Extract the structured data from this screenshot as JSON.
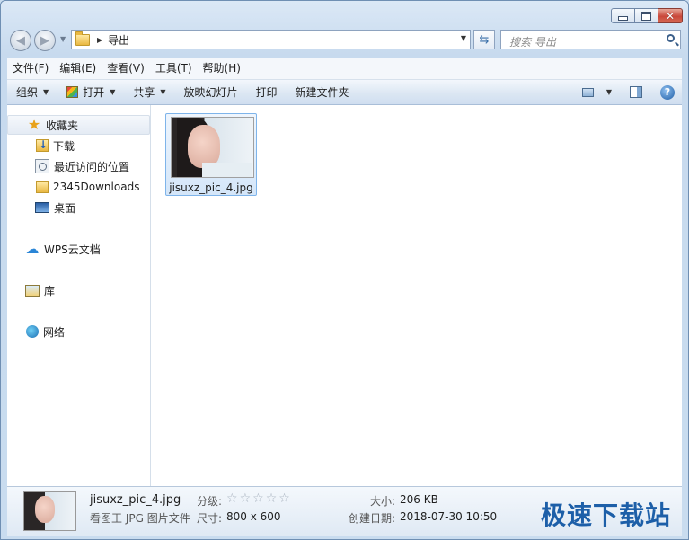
{
  "address": {
    "folder": "导出",
    "search_placeholder": "搜索 导出"
  },
  "menu": [
    "文件(F)",
    "编辑(E)",
    "查看(V)",
    "工具(T)",
    "帮助(H)"
  ],
  "toolbar": {
    "organize": "组织",
    "open": "打开",
    "share": "共享",
    "slideshow": "放映幻灯片",
    "print": "打印",
    "new_folder": "新建文件夹"
  },
  "nav": {
    "favorites": "收藏夹",
    "downloads": "下载",
    "recent": "最近访问的位置",
    "folder2345": "2345Downloads",
    "desktop": "桌面",
    "wps": "WPS云文档",
    "library": "库",
    "network": "网络"
  },
  "file": {
    "name": "jisuxz_pic_4.jpg"
  },
  "details": {
    "name": "jisuxz_pic_4.jpg",
    "type": "看图王 JPG 图片文件",
    "rating_label": "分级:",
    "dims_label": "尺寸:",
    "dims_value": "800 x 600",
    "size_label": "大小:",
    "size_value": "206 KB",
    "created_label": "创建日期:",
    "created_value": "2018-07-30 10:50",
    "rating_stars": 0
  },
  "watermark": "极速下载站"
}
